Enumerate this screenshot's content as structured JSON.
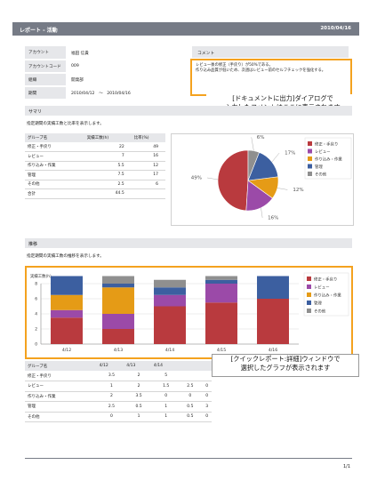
{
  "header": {
    "title": "レポート - 活動",
    "date": "2010/04/16"
  },
  "info": [
    {
      "key": "アカウント",
      "value": "福田 信貴"
    },
    {
      "key": "アカウントコード",
      "value": "009"
    },
    {
      "key": "組織",
      "value": "開発部"
    },
    {
      "key": "期間",
      "value": "2010/04/12　～　2010/04/16"
    }
  ],
  "comment": {
    "title": "コメント",
    "line1": "レビュー後の修正（手戻り）が50%である。",
    "line2": "作り込み品質が低いため、次週はレビュー前のセルフチェックを強化する。"
  },
  "callout1": {
    "line1": "[ドキュメントに出力]ダイアログで",
    "line2": "入力したコメントはここに表示されます"
  },
  "summary": {
    "title": "サマリ",
    "desc": "指定期間の実績工数と比率を表示します。",
    "headers": [
      "グループ名",
      "実績工数(h)",
      "比率(%)"
    ],
    "rows": [
      [
        "修正・手戻り",
        "22",
        "49"
      ],
      [
        "レビュー",
        "7",
        "16"
      ],
      [
        "作り込み・作業",
        "5.5",
        "12"
      ],
      [
        "管理",
        "7.5",
        "17"
      ],
      [
        "その他",
        "2.5",
        "6"
      ]
    ],
    "total_label": "合計",
    "total_value": "44.5"
  },
  "trend": {
    "title": "推移",
    "desc": "指定期間の実績工数の推移を表示します。",
    "headers": [
      "グループ名",
      "4/12",
      "4/13",
      "4/14",
      "",
      ""
    ],
    "rows": [
      [
        "修正・手戻り",
        "3.5",
        "2",
        "5",
        "",
        ""
      ],
      [
        "レビュー",
        "1",
        "2",
        "1.5",
        "2.5",
        "0"
      ],
      [
        "作り込み・作業",
        "2",
        "3.5",
        "0",
        "0",
        "0"
      ],
      [
        "管理",
        "2.5",
        "0.5",
        "1",
        "0.5",
        "3"
      ],
      [
        "その他",
        "0",
        "1",
        "1",
        "0.5",
        "0"
      ]
    ]
  },
  "callout2": {
    "line1": "[クイックレポート:詳細]ウィンドウで",
    "line2": "選択したグラフが表示されます"
  },
  "footer": {
    "page": "1/1"
  },
  "colors": {
    "rework": "#b93a3e",
    "review": "#9b4aa8",
    "build": "#e59b16",
    "manage": "#3c5fa0",
    "other": "#8f8f8f",
    "accent": "#f4a21f",
    "header": "#767b86"
  },
  "chart_data": [
    {
      "type": "pie",
      "categories": [
        "修正・手戻り",
        "レビュー",
        "作り込み・作業",
        "管理",
        "その他"
      ],
      "values": [
        49,
        16,
        12,
        17,
        6
      ],
      "labels": [
        "49%",
        "16%",
        "12%",
        "17%",
        "6%"
      ]
    },
    {
      "type": "bar",
      "stacked": true,
      "ylabel": "実績工数(h)",
      "categories": [
        "4/12",
        "4/13",
        "4/14",
        "4/15",
        "4/16"
      ],
      "ylim": [
        0,
        8
      ],
      "yticks": [
        "0",
        "2",
        "4",
        "6",
        "8"
      ],
      "series": [
        {
          "name": "修正・手戻り",
          "values": [
            3.5,
            2,
            5,
            5.5,
            6
          ]
        },
        {
          "name": "レビュー",
          "values": [
            1,
            2,
            1.5,
            2.5,
            0
          ]
        },
        {
          "name": "作り込み・作業",
          "values": [
            2,
            3.5,
            0,
            0,
            0
          ]
        },
        {
          "name": "管理",
          "values": [
            2.5,
            0.5,
            1,
            0.5,
            3
          ]
        },
        {
          "name": "その他",
          "values": [
            0,
            1,
            1,
            0.5,
            0
          ]
        }
      ]
    }
  ]
}
